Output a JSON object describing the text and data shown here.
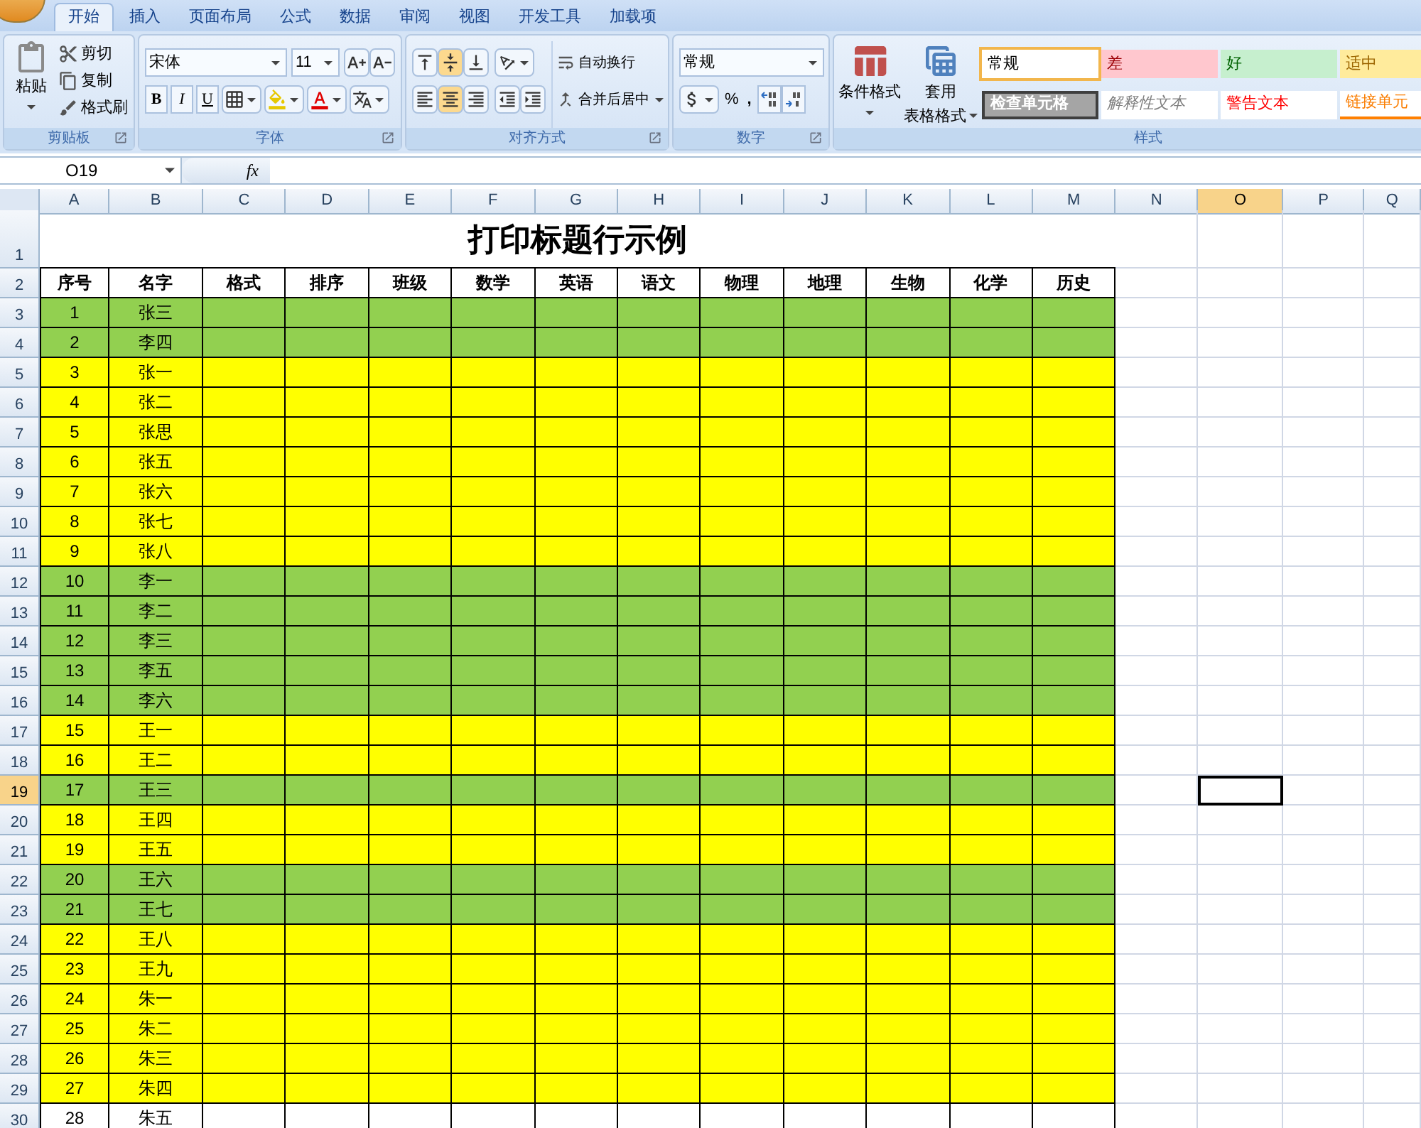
{
  "tabs": [
    {
      "label": "开始",
      "selected": true
    },
    {
      "label": "插入",
      "selected": false
    },
    {
      "label": "页面布局",
      "selected": false
    },
    {
      "label": "公式",
      "selected": false
    },
    {
      "label": "数据",
      "selected": false
    },
    {
      "label": "审阅",
      "selected": false
    },
    {
      "label": "视图",
      "selected": false
    },
    {
      "label": "开发工具",
      "selected": false
    },
    {
      "label": "加载项",
      "selected": false
    }
  ],
  "ribbon": {
    "clipboard": {
      "paste": "粘贴",
      "cut": "剪切",
      "copy": "复制",
      "format_painter": "格式刷",
      "group_label": "剪贴板"
    },
    "font": {
      "font_name": "宋体",
      "font_size": "11",
      "bold": "B",
      "italic": "I",
      "underline": "U",
      "group_label": "字体"
    },
    "alignment": {
      "vertical": [
        {
          "kind": "top",
          "selected": false
        },
        {
          "kind": "middle",
          "selected": true
        },
        {
          "kind": "bottom",
          "selected": false
        }
      ],
      "horizontal": [
        {
          "kind": "left",
          "selected": false
        },
        {
          "kind": "center",
          "selected": true
        },
        {
          "kind": "right",
          "selected": false
        }
      ],
      "wrap_text": "自动换行",
      "merge_center": "合并后居中",
      "group_label": "对齐方式"
    },
    "number": {
      "format": "常规",
      "percent": "%",
      "comma": ",",
      "group_label": "数字"
    },
    "styles": {
      "conditional_format": "条件格式",
      "table_format_top": "套用",
      "table_format_bottom": "表格格式",
      "group_label": "样式",
      "gallery": [
        {
          "label": "常规",
          "kind": "normal",
          "selected": true
        },
        {
          "label": "差",
          "kind": "bad",
          "selected": false
        },
        {
          "label": "好",
          "kind": "good",
          "selected": false
        },
        {
          "label": "适中",
          "kind": "neutral",
          "selected": false
        },
        {
          "label": "检查单元格",
          "kind": "check",
          "selected": false
        },
        {
          "label": "解释性文本",
          "kind": "explanatory",
          "selected": false
        },
        {
          "label": "警告文本",
          "kind": "warning",
          "selected": false
        },
        {
          "label": "链接单元",
          "kind": "linked",
          "selected": false
        }
      ]
    }
  },
  "formula_bar": {
    "name_box": "O19",
    "function_label": "fx"
  },
  "sheet": {
    "columns": [
      {
        "letter": "A",
        "selected": false
      },
      {
        "letter": "B",
        "selected": false
      },
      {
        "letter": "C",
        "selected": false
      },
      {
        "letter": "D",
        "selected": false
      },
      {
        "letter": "E",
        "selected": false
      },
      {
        "letter": "F",
        "selected": false
      },
      {
        "letter": "G",
        "selected": false
      },
      {
        "letter": "H",
        "selected": false
      },
      {
        "letter": "I",
        "selected": false
      },
      {
        "letter": "J",
        "selected": false
      },
      {
        "letter": "K",
        "selected": false
      },
      {
        "letter": "L",
        "selected": false
      },
      {
        "letter": "M",
        "selected": false
      },
      {
        "letter": "N",
        "selected": false
      },
      {
        "letter": "O",
        "selected": true
      },
      {
        "letter": "P",
        "selected": false
      },
      {
        "letter": "Q",
        "selected": false
      }
    ],
    "title": "打印标题行示例",
    "headers": [
      "序号",
      "名字",
      "格式",
      "排序",
      "班级",
      "数学",
      "英语",
      "语文",
      "物理",
      "地理",
      "生物",
      "化学",
      "历史"
    ],
    "row_headers": [
      {
        "label": "1",
        "selected": false
      },
      {
        "label": "2",
        "selected": false
      },
      {
        "label": "3",
        "selected": false
      },
      {
        "label": "4",
        "selected": false
      },
      {
        "label": "5",
        "selected": false
      },
      {
        "label": "6",
        "selected": false
      },
      {
        "label": "7",
        "selected": false
      },
      {
        "label": "8",
        "selected": false
      },
      {
        "label": "9",
        "selected": false
      },
      {
        "label": "10",
        "selected": false
      },
      {
        "label": "11",
        "selected": false
      },
      {
        "label": "12",
        "selected": false
      },
      {
        "label": "13",
        "selected": false
      },
      {
        "label": "14",
        "selected": false
      },
      {
        "label": "15",
        "selected": false
      },
      {
        "label": "16",
        "selected": false
      },
      {
        "label": "17",
        "selected": false
      },
      {
        "label": "18",
        "selected": false
      },
      {
        "label": "19",
        "selected": true
      },
      {
        "label": "20",
        "selected": false
      },
      {
        "label": "21",
        "selected": false
      },
      {
        "label": "22",
        "selected": false
      },
      {
        "label": "23",
        "selected": false
      },
      {
        "label": "24",
        "selected": false
      },
      {
        "label": "25",
        "selected": false
      },
      {
        "label": "26",
        "selected": false
      },
      {
        "label": "27",
        "selected": false
      },
      {
        "label": "28",
        "selected": false
      },
      {
        "label": "29",
        "selected": false
      },
      {
        "label": "30",
        "selected": false
      }
    ],
    "rows": [
      {
        "no": "1",
        "name": "张三",
        "color": "#92d050"
      },
      {
        "no": "2",
        "name": "李四",
        "color": "#92d050"
      },
      {
        "no": "3",
        "name": "张一",
        "color": "#ffff00"
      },
      {
        "no": "4",
        "name": "张二",
        "color": "#ffff00"
      },
      {
        "no": "5",
        "name": "张思",
        "color": "#ffff00"
      },
      {
        "no": "6",
        "name": "张五",
        "color": "#ffff00"
      },
      {
        "no": "7",
        "name": "张六",
        "color": "#ffff00"
      },
      {
        "no": "8",
        "name": "张七",
        "color": "#ffff00"
      },
      {
        "no": "9",
        "name": "张八",
        "color": "#ffff00"
      },
      {
        "no": "10",
        "name": "李一",
        "color": "#92d050"
      },
      {
        "no": "11",
        "name": "李二",
        "color": "#92d050"
      },
      {
        "no": "12",
        "name": "李三",
        "color": "#92d050"
      },
      {
        "no": "13",
        "name": "李五",
        "color": "#92d050"
      },
      {
        "no": "14",
        "name": "李六",
        "color": "#92d050"
      },
      {
        "no": "15",
        "name": "王一",
        "color": "#ffff00"
      },
      {
        "no": "16",
        "name": "王二",
        "color": "#ffff00"
      },
      {
        "no": "17",
        "name": "王三",
        "color": "#92d050"
      },
      {
        "no": "18",
        "name": "王四",
        "color": "#ffff00"
      },
      {
        "no": "19",
        "name": "王五",
        "color": "#ffff00"
      },
      {
        "no": "20",
        "name": "王六",
        "color": "#92d050"
      },
      {
        "no": "21",
        "name": "王七",
        "color": "#92d050"
      },
      {
        "no": "22",
        "name": "王八",
        "color": "#ffff00"
      },
      {
        "no": "23",
        "name": "王九",
        "color": "#ffff00"
      },
      {
        "no": "24",
        "name": "朱一",
        "color": "#ffff00"
      },
      {
        "no": "25",
        "name": "朱二",
        "color": "#ffff00"
      },
      {
        "no": "26",
        "name": "朱三",
        "color": "#ffff00"
      },
      {
        "no": "27",
        "name": "朱四",
        "color": "#ffff00"
      },
      {
        "no": "28",
        "name": "朱五",
        "color": "#ffffff"
      }
    ]
  }
}
